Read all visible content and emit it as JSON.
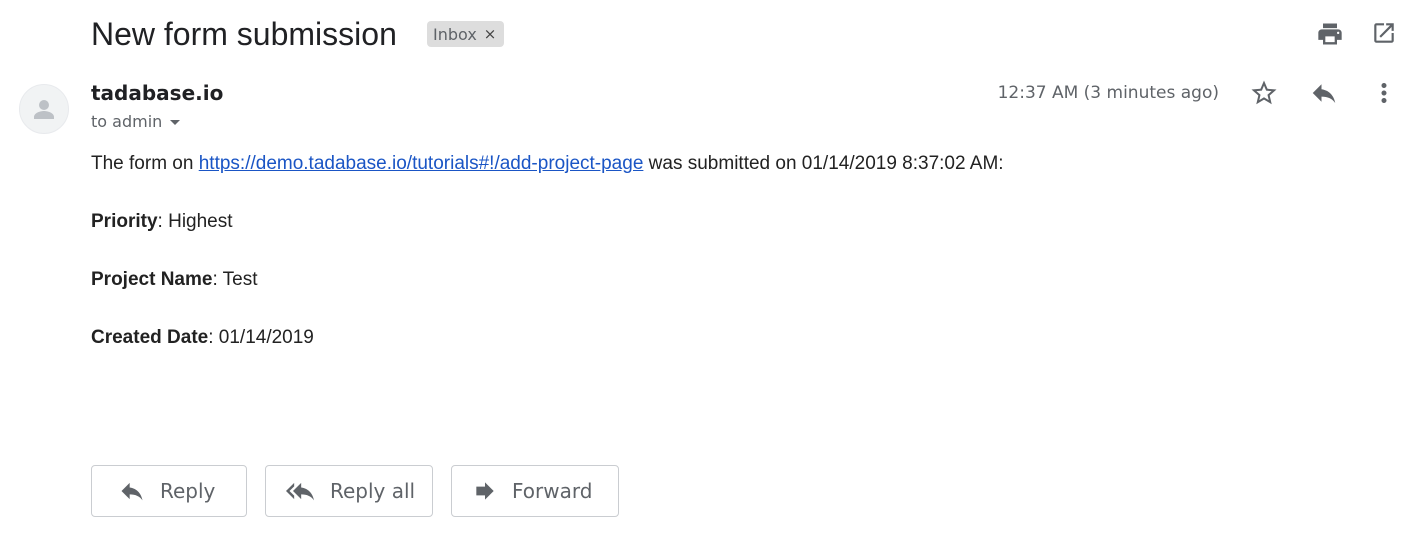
{
  "subject": "New form submission",
  "label_chip": {
    "text": "Inbox",
    "close_glyph": "×"
  },
  "top_actions": {
    "print_icon": "print-icon",
    "open_new_window_icon": "open-in-new-icon"
  },
  "message": {
    "sender_name": "tadabase.io",
    "recipient_line": "to admin",
    "timestamp": "12:37 AM (3 minutes ago)",
    "header_icons": [
      "star-icon",
      "reply-icon",
      "more-vert-icon"
    ],
    "body": {
      "intro_prefix": "The form on ",
      "link_text": "https://demo.tadabase.io/tutorials#!/add-project-page",
      "intro_suffix": " was submitted on 01/14/2019 8:37:02 AM:",
      "fields": [
        {
          "label": "Priority",
          "separator": ": ",
          "value": "Highest"
        },
        {
          "label": "Project Name",
          "separator": ": ",
          "value": "Test"
        },
        {
          "label": "Created Date",
          "separator": ": ",
          "value": "01/14/2019"
        }
      ]
    }
  },
  "footer_buttons": {
    "reply": "Reply",
    "reply_all": "Reply all",
    "forward": "Forward"
  },
  "colors": {
    "link": "#1a55c5",
    "chip_bg": "#dddddd",
    "icon_gray": "#5f6368"
  }
}
